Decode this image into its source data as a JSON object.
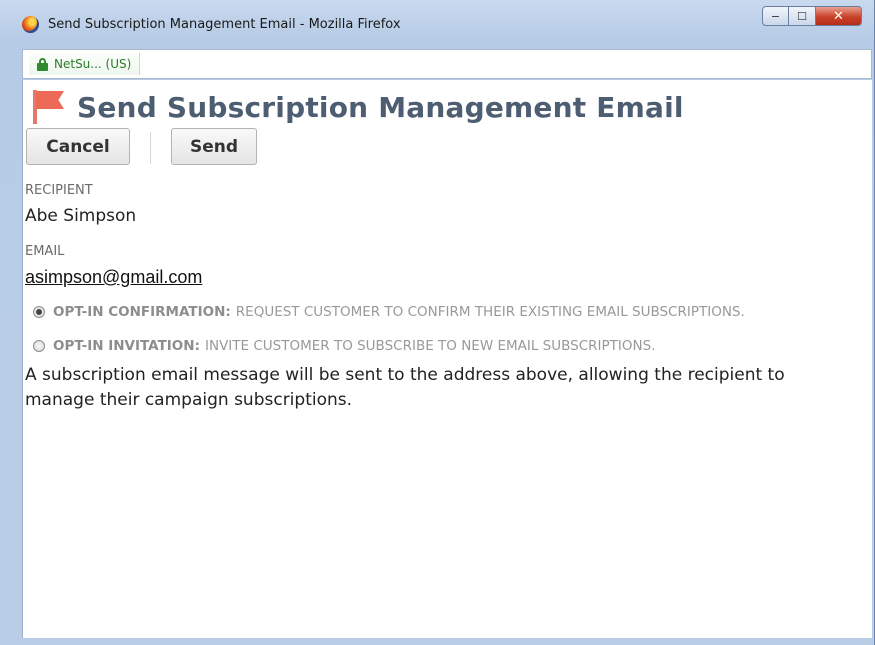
{
  "window": {
    "title": "Send Subscription Management Email - Mozilla Firefox",
    "controls": {
      "minimize": "−",
      "maximize": "☐",
      "close": "✕"
    }
  },
  "urlbar": {
    "site_identity": "NetSu... (US)"
  },
  "page": {
    "title": "Send Subscription Management Email",
    "buttons": {
      "cancel": "Cancel",
      "send": "Send"
    },
    "recipient": {
      "label": "RECIPIENT",
      "value": "Abe Simpson"
    },
    "email": {
      "label": "EMAIL",
      "value": "asimpson@gmail.com"
    },
    "options": [
      {
        "key": "OPT-IN CONFIRMATION:",
        "text": "REQUEST CUSTOMER TO CONFIRM THEIR EXISTING EMAIL SUBSCRIPTIONS.",
        "selected": true
      },
      {
        "key": "OPT-IN INVITATION:",
        "text": "INVITE CUSTOMER TO SUBSCRIBE TO NEW EMAIL SUBSCRIPTIONS.",
        "selected": false
      }
    ],
    "description": "A subscription email message will be sent to the address above, allowing the recipient to manage their campaign subscriptions."
  },
  "colors": {
    "title": "#4d5e73",
    "flag": "#ee6a58",
    "secure": "#2f8a2f"
  }
}
